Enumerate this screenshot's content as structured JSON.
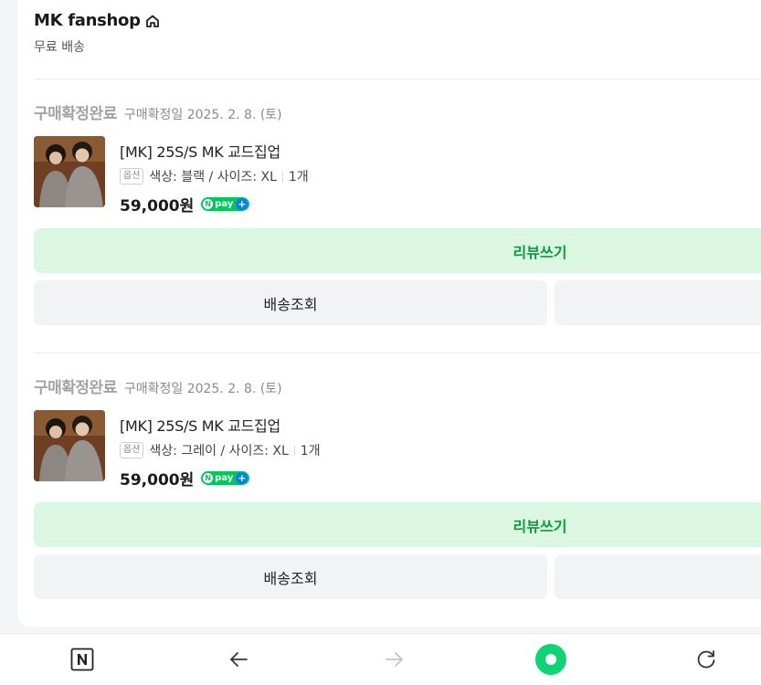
{
  "shop": {
    "name": "MK fanshop",
    "shipping": "무료 배송"
  },
  "orders": [
    {
      "status": "구매확정완료",
      "confirm_date": "구매확정일 2025. 2. 8. (토)",
      "product_name": "[MK] 25S/S MK 교드집업",
      "option_badge": "옵션",
      "option_text": "색상: 블랙 / 사이즈: XL",
      "quantity": "1개",
      "price": "59,000원",
      "npay_label": "pay",
      "review_button": "리뷰쓰기",
      "track_button": "배송조회"
    },
    {
      "status": "구매확정완료",
      "confirm_date": "구매확정일 2025. 2. 8. (토)",
      "product_name": "[MK] 25S/S MK 교드집업",
      "option_badge": "옵션",
      "option_text": "색상: 그레이 / 사이즈: XL",
      "quantity": "1개",
      "price": "59,000원",
      "npay_label": "pay",
      "review_button": "리뷰쓰기",
      "track_button": "배송조회"
    }
  ],
  "bottom_nav": {
    "items": [
      "naver-n-icon",
      "back-arrow-icon",
      "forward-arrow-icon",
      "green-dot-icon",
      "refresh-icon"
    ],
    "accent": "#03c75a"
  },
  "colors": {
    "review_bg": "#dbf7e1",
    "review_text": "#0b9b3c",
    "status_gray": "#a3a3a3"
  }
}
